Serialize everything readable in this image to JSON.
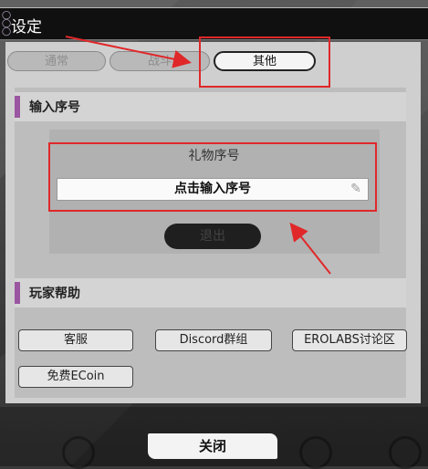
{
  "window": {
    "title": "设定"
  },
  "tabs": [
    {
      "label": "通常",
      "active": false
    },
    {
      "label": "战斗",
      "active": false
    },
    {
      "label": "其他",
      "active": true
    }
  ],
  "section_serial": {
    "heading": "输入序号",
    "gift_title": "礼物序号",
    "input_placeholder": "点击输入序号",
    "exit_label": "退出"
  },
  "section_help": {
    "heading": "玩家帮助",
    "buttons": [
      "客服",
      "Discord群组",
      "EROLABS讨论区",
      "免费ECoin"
    ]
  },
  "footer": {
    "close_label": "关闭"
  },
  "colors": {
    "accent": "#9a56a0",
    "annotation": "#e0282a"
  }
}
